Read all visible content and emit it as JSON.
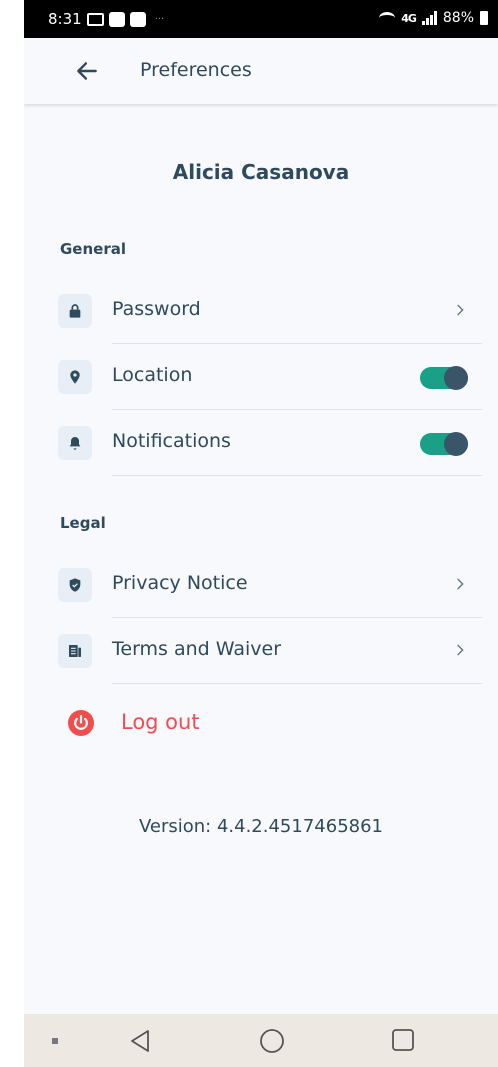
{
  "status_bar": {
    "time": "8:31",
    "network": "4G",
    "battery": "88%"
  },
  "header": {
    "title": "Preferences",
    "back_icon": "arrow-left-icon"
  },
  "user": {
    "name": "Alicia Casanova"
  },
  "sections": {
    "general": {
      "title": "General",
      "items": [
        {
          "label": "Password",
          "icon": "lock-icon",
          "control": "chevron"
        },
        {
          "label": "Location",
          "icon": "location-pin-icon",
          "control": "toggle",
          "on": true
        },
        {
          "label": "Notifications",
          "icon": "bell-icon",
          "control": "toggle",
          "on": true
        }
      ]
    },
    "legal": {
      "title": "Legal",
      "items": [
        {
          "label": "Privacy Notice",
          "icon": "shield-check-icon",
          "control": "chevron"
        },
        {
          "label": "Terms and Waiver",
          "icon": "document-icon",
          "control": "chevron"
        }
      ]
    }
  },
  "logout": {
    "label": "Log out",
    "icon": "power-icon"
  },
  "version": "Version: 4.4.2.4517465861",
  "colors": {
    "text": "#2f4a5c",
    "accent_toggle": "#1aa086",
    "toggle_knob": "#3a5468",
    "logout": "#f24d4d",
    "background": "#f7f9fc",
    "icon_bg": "#e7eef5"
  },
  "nav_bar": {
    "buttons": [
      "back-triangle-icon",
      "home-circle-icon",
      "recents-square-icon"
    ]
  }
}
